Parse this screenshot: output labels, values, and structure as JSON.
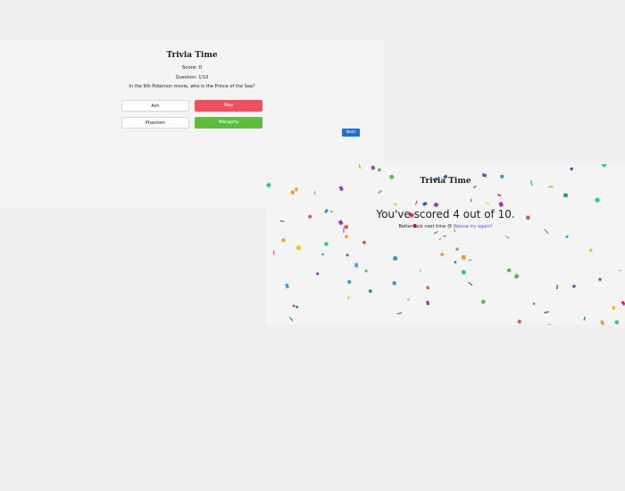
{
  "quiz": {
    "title": "Trivia Time",
    "score": "Score: 0",
    "question_counter": "Question: 1/10",
    "question": "In the 9th Pokemon movie, who is the Prince of the Sea?",
    "answers": [
      {
        "label": "Ash",
        "state": "neutral"
      },
      {
        "label": "May",
        "state": "wrong"
      },
      {
        "label": "Phantom",
        "state": "neutral"
      },
      {
        "label": "Manaphy",
        "state": "correct"
      }
    ],
    "next_label": "Next"
  },
  "result": {
    "title": "Trivia Time",
    "score_text": "You've scored 4 out of 10.",
    "message": "Better luck next time",
    "emoji": "😞",
    "retry_link": "Wanna try again?"
  },
  "colors": {
    "wrong": "#f0505d",
    "correct": "#5bbf3a",
    "next_button": "#1f6fd6",
    "link": "#5b4dd6",
    "confetti": [
      "#e84c3d",
      "#f39c12",
      "#f1c40f",
      "#2ecc71",
      "#16a085",
      "#3498db",
      "#1e5fb5",
      "#8e44ad",
      "#9b32c8",
      "#e91e63",
      "#3f51b5",
      "#55b947"
    ]
  }
}
